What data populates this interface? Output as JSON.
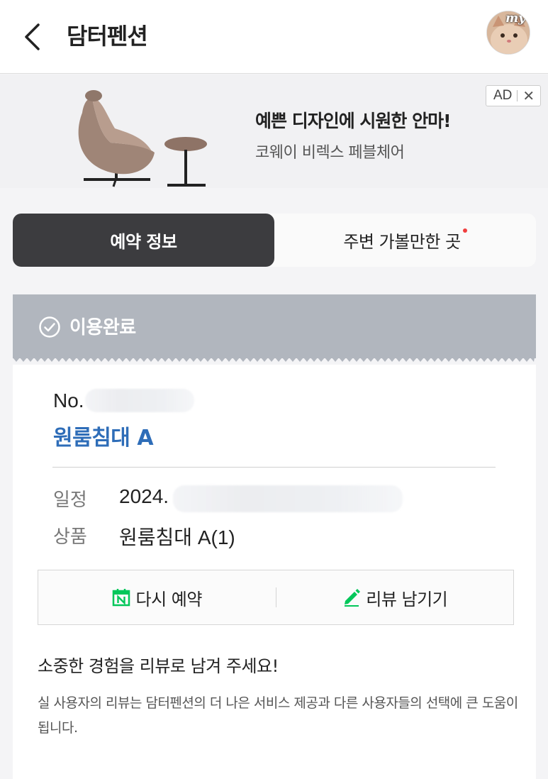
{
  "header": {
    "title": "담터펜션",
    "avatar_label": "my"
  },
  "ad": {
    "badge": "AD",
    "close": "✕",
    "headline": "예쁜 디자인에 시원한 안마!",
    "subtitle": "코웨이 비렉스 페블체어"
  },
  "tabs": [
    {
      "label": "예약 정보",
      "active": true
    },
    {
      "label": "주변 가볼만한 곳",
      "active": false,
      "has_dot": true
    }
  ],
  "status": {
    "label": "이용완료"
  },
  "reservation": {
    "no_label": "No.",
    "room_name": "원룸침대 A",
    "date_label": "일정",
    "date_value": "2024.",
    "product_label": "상품",
    "product_value": "원룸침대 A(1)"
  },
  "actions": {
    "rebook_label": "다시 예약",
    "review_label": "리뷰 남기기"
  },
  "review_prompt": {
    "title": "소중한 경험을 리뷰로 남겨 주세요!",
    "description": "실 사용자의 리뷰는 담터펜션의 더 나은 서비스 제공과 다른 사용자들의 선택에 큰 도움이 됩니다."
  },
  "colors": {
    "accent_blue": "#2e6db8",
    "tab_active_bg": "#3c3c3f",
    "status_bg": "#b1b6be",
    "naver_green": "#03c75a",
    "notification_dot": "#f03e3e"
  }
}
